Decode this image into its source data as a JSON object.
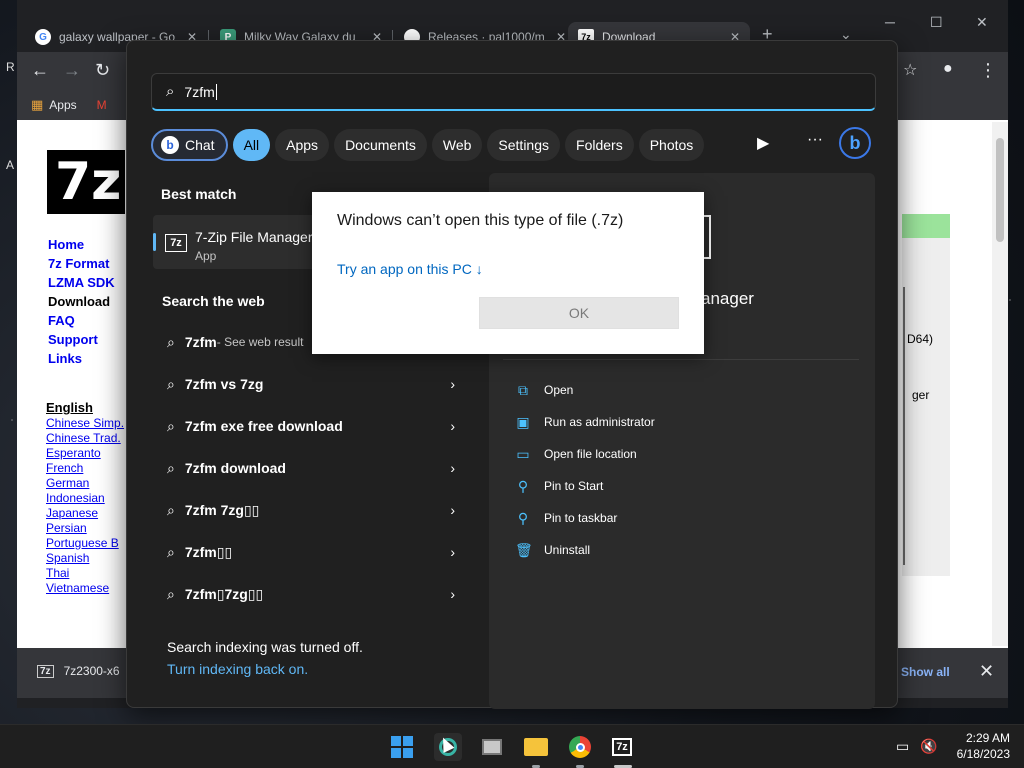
{
  "desktop": {
    "label_r": "R",
    "label_a": "A"
  },
  "chrome": {
    "tabs": [
      {
        "title": "galaxy wallpaper - Go",
        "favicon": "G",
        "favicon_color": "#4285f4"
      },
      {
        "title": "Milky Way Galaxy du",
        "favicon": "P",
        "favicon_color": "#3a9b7a"
      },
      {
        "title": "Releases · pal1000/m",
        "favicon": "",
        "favicon_color": "#ffffff"
      },
      {
        "title": "Download",
        "favicon": "7z",
        "favicon_color": "#000000"
      }
    ],
    "new_tab": "+",
    "bookmarks": {
      "apps_label": "Apps"
    },
    "page": {
      "logo": "7z",
      "nav": [
        "Home",
        "7z Format",
        "LZMA SDK",
        "Download",
        "FAQ",
        "Support",
        "Links"
      ],
      "languages_heading": "English",
      "languages": [
        "Chinese Simp.",
        "Chinese Trad.",
        "Esperanto",
        "French",
        "German",
        "Indonesian",
        "Japanese",
        "Persian",
        "Portuguese B",
        "Spanish",
        "Thai",
        "Vietnamese"
      ],
      "partial_text_1": "D64)",
      "partial_text_2": "ger"
    },
    "download_bar": {
      "file": "7z2300-x6",
      "show_all": "Show all"
    }
  },
  "search": {
    "query": "7zfm",
    "filters": [
      "Chat",
      "All",
      "Apps",
      "Documents",
      "Web",
      "Settings",
      "Folders",
      "Photos"
    ],
    "active_filter": "All",
    "best_match_title": "Best match",
    "best_match": {
      "name": "7-Zip File Manager",
      "type": "App",
      "icon_text": "7z"
    },
    "search_web_title": "Search the web",
    "web_results": [
      {
        "query": "7zfm",
        "suffix": " - See web result"
      },
      {
        "query": "7zfm vs 7zg",
        "suffix": ""
      },
      {
        "query": "7zfm exe free download",
        "suffix": ""
      },
      {
        "query": "7zfm download",
        "suffix": ""
      },
      {
        "query": "7zfm 7zg▯▯",
        "suffix": ""
      },
      {
        "query": "7zfm▯▯",
        "suffix": ""
      },
      {
        "query": "7zfm▯7zg▯▯",
        "suffix": ""
      }
    ],
    "indexing_off": "Search indexing was turned off.",
    "indexing_on": "Turn indexing back on.",
    "detail_title": "anager",
    "actions": [
      {
        "label": "Open",
        "icon": "open-icon"
      },
      {
        "label": "Run as administrator",
        "icon": "shield-icon"
      },
      {
        "label": "Open file location",
        "icon": "folder-icon"
      },
      {
        "label": "Pin to Start",
        "icon": "pin-icon"
      },
      {
        "label": "Pin to taskbar",
        "icon": "pin-icon"
      },
      {
        "label": "Uninstall",
        "icon": "trash-icon"
      }
    ]
  },
  "dialog": {
    "title": "Windows can’t open this type of file (.7z)",
    "link": "Try an app on this PC ↓",
    "ok": "OK"
  },
  "taskbar": {
    "time": "2:29 AM",
    "date": "6/18/2023",
    "accent": "#3aa0f0"
  }
}
